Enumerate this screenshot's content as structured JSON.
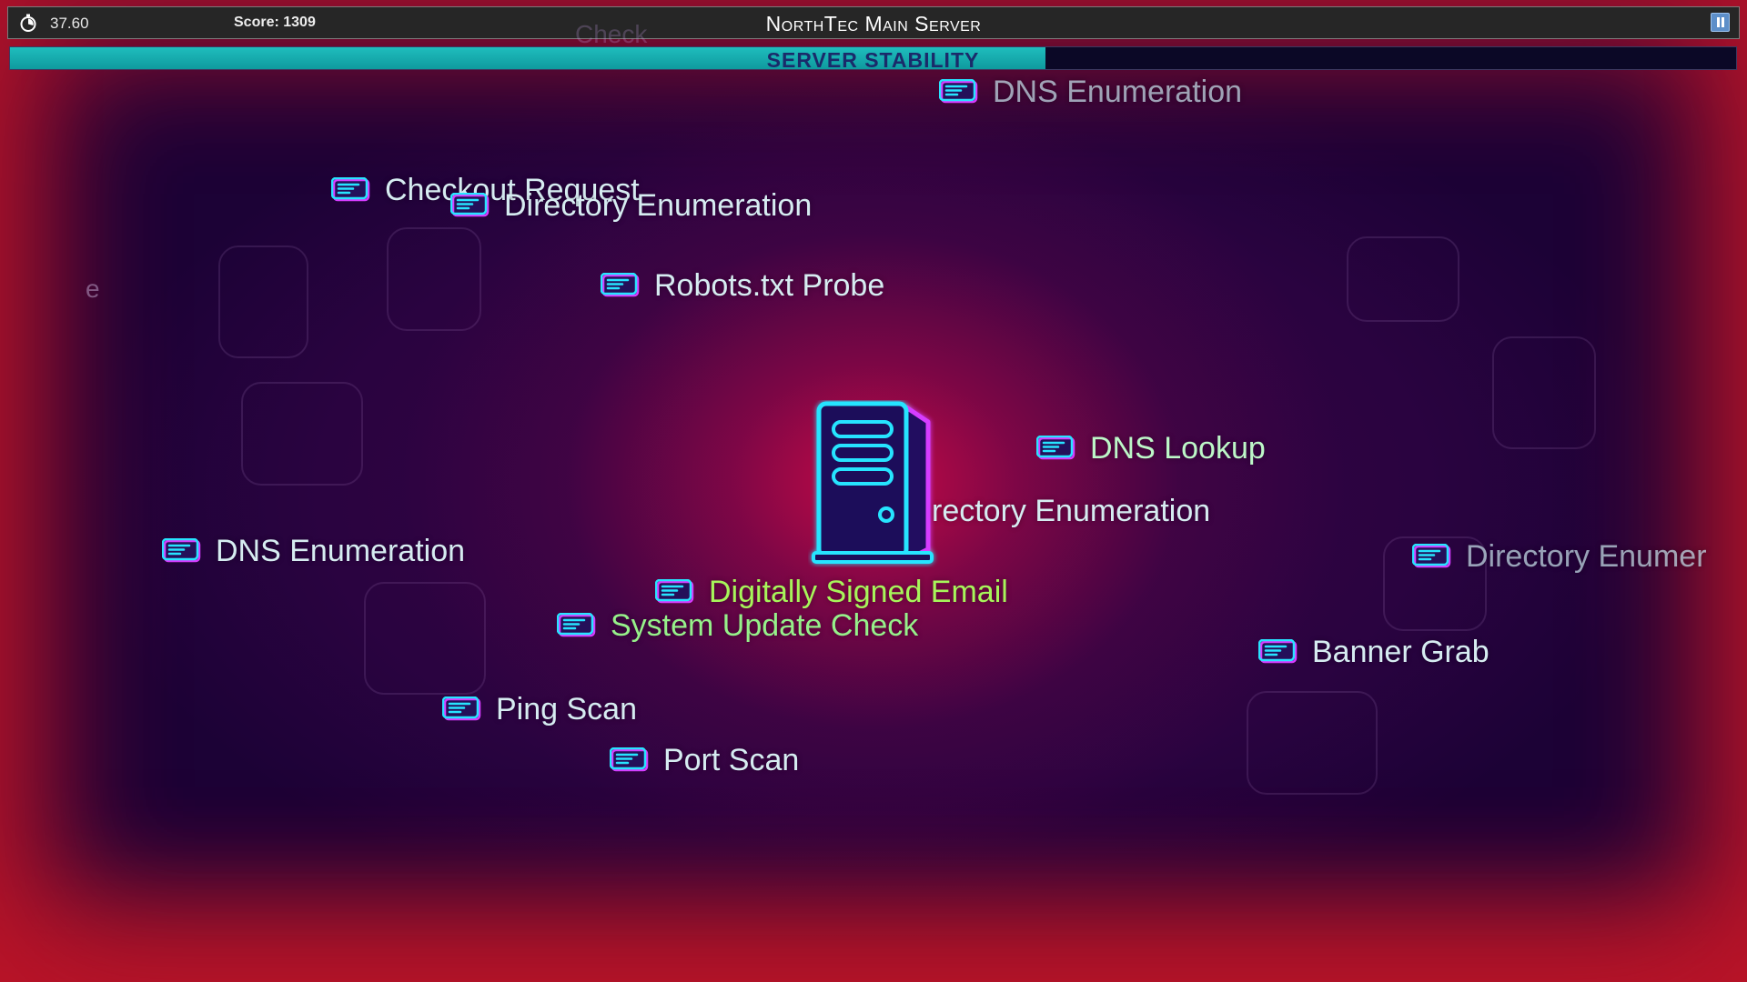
{
  "hud": {
    "timer": "37.60",
    "score": "Score: 1309",
    "title": "NorthTec Main Server",
    "pause_icon": "pause-icon",
    "timer_icon": "stopwatch-icon"
  },
  "stability": {
    "label": "SERVER STABILITY",
    "level": 0.6,
    "fill_color": "#17b3b3"
  },
  "ghost_text": {
    "check": "Check",
    "e": "e"
  },
  "packets": [
    {
      "label": "DNS Enumeration"
    },
    {
      "label": "Checkout Request"
    },
    {
      "label": "Directory Enumeration"
    },
    {
      "label": "Robots.txt Probe"
    },
    {
      "label": "DNS Lookup"
    },
    {
      "label": "rectory Enumeration"
    },
    {
      "label": "DNS Enumeration"
    },
    {
      "label": "Directory Enumer"
    },
    {
      "label": "Digitally Signed Email"
    },
    {
      "label": "System Update Check"
    },
    {
      "label": "Banner Grab"
    },
    {
      "label": "Ping Scan"
    },
    {
      "label": "Port Scan"
    }
  ],
  "colors": {
    "neon_cyan": "#27e4ff",
    "neon_magenta": "#d63cff",
    "background_core": "#c80a46"
  }
}
